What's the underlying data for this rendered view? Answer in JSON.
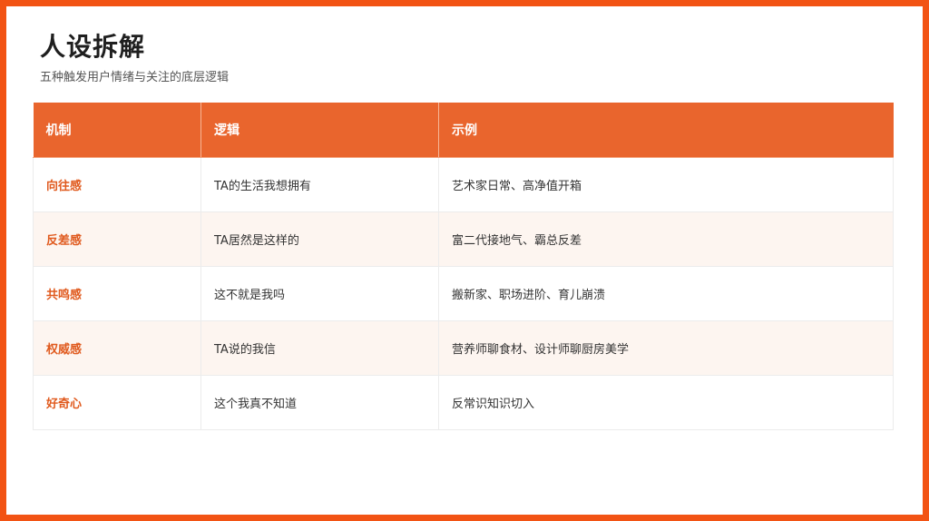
{
  "slide": {
    "title": "人设拆解",
    "subtitle": "五种触发用户情绪与关注的底层逻辑",
    "accent_color": "#e9652d",
    "border_color": "#f25314"
  },
  "table": {
    "headers": [
      "机制",
      "逻辑",
      "示例"
    ],
    "rows": [
      {
        "mechanism": "向往感",
        "logic": "TA的生活我想拥有",
        "example": "艺术家日常、高净值开箱"
      },
      {
        "mechanism": "反差感",
        "logic": "TA居然是这样的",
        "example": "富二代接地气、霸总反差"
      },
      {
        "mechanism": "共鸣感",
        "logic": "这不就是我吗",
        "example": "搬新家、职场进阶、育儿崩溃"
      },
      {
        "mechanism": "权威感",
        "logic": "TA说的我信",
        "example": "营养师聊食材、设计师聊厨房美学"
      },
      {
        "mechanism": "好奇心",
        "logic": "这个我真不知道",
        "example": "反常识知识切入"
      }
    ]
  }
}
